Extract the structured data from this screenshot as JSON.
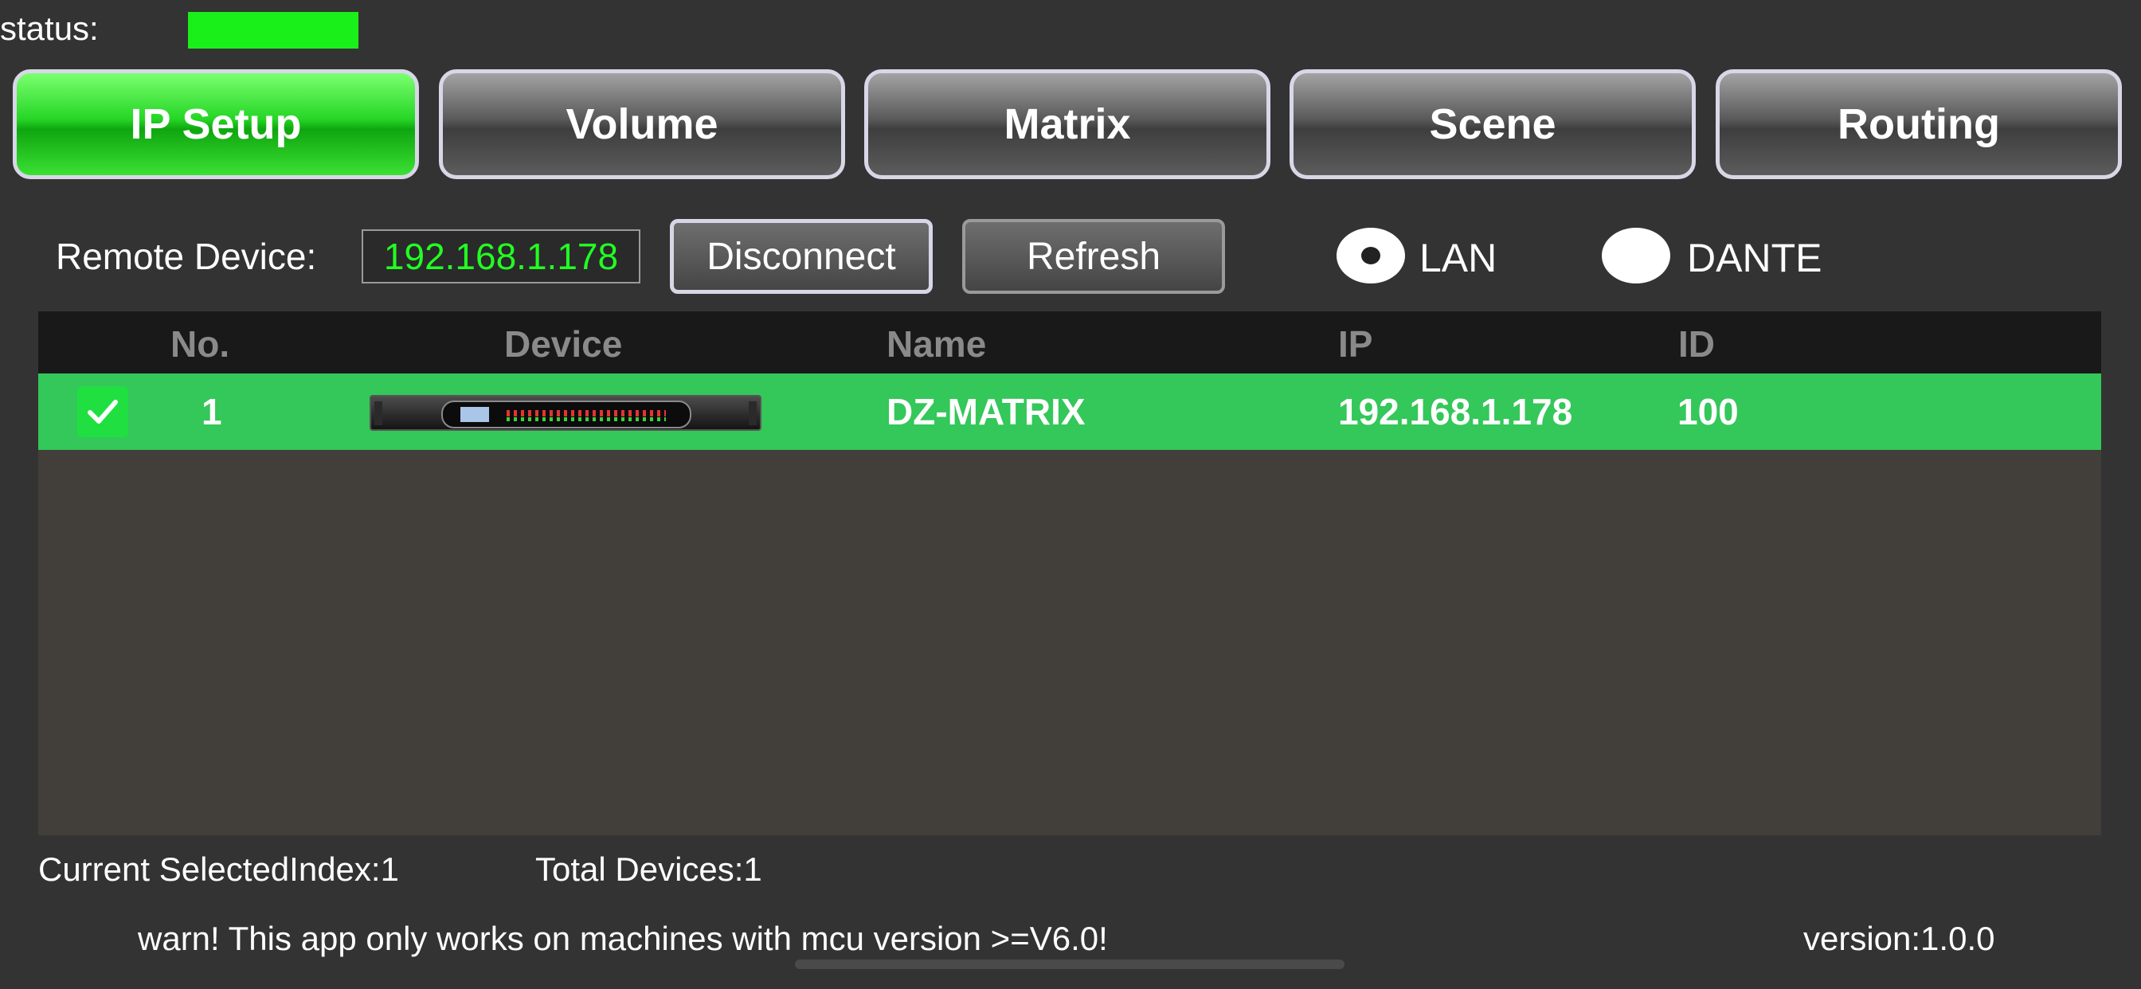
{
  "status": {
    "label": "status:",
    "indicator_color": "#19f019"
  },
  "tabs": [
    {
      "label": "IP Setup",
      "active": true
    },
    {
      "label": "Volume",
      "active": false
    },
    {
      "label": "Matrix",
      "active": false
    },
    {
      "label": "Scene",
      "active": false
    },
    {
      "label": "Routing",
      "active": false
    }
  ],
  "remote": {
    "label": "Remote Device:",
    "ip": "192.168.1.178",
    "disconnect_label": "Disconnect",
    "refresh_label": "Refresh"
  },
  "network": {
    "options": [
      {
        "label": "LAN",
        "selected": true
      },
      {
        "label": "DANTE",
        "selected": false
      }
    ]
  },
  "table": {
    "columns": [
      "No.",
      "Device",
      "Name",
      "IP",
      "ID"
    ],
    "rows": [
      {
        "checked": true,
        "no": "1",
        "device_icon": "rack-device-image",
        "name": "DZ-MATRIX",
        "ip": "192.168.1.178",
        "id": "100"
      }
    ]
  },
  "footer": {
    "selected_index": "Current SelectedIndex:1",
    "total_devices": "Total Devices:1",
    "warning": "warn! This app only works on machines with mcu version >=V6.0!",
    "version": "version:1.0.0"
  },
  "colors": {
    "accent_green": "#34c759",
    "active_tab_green": "#26d626",
    "ip_text_green": "#22ff22",
    "background": "#333333"
  }
}
